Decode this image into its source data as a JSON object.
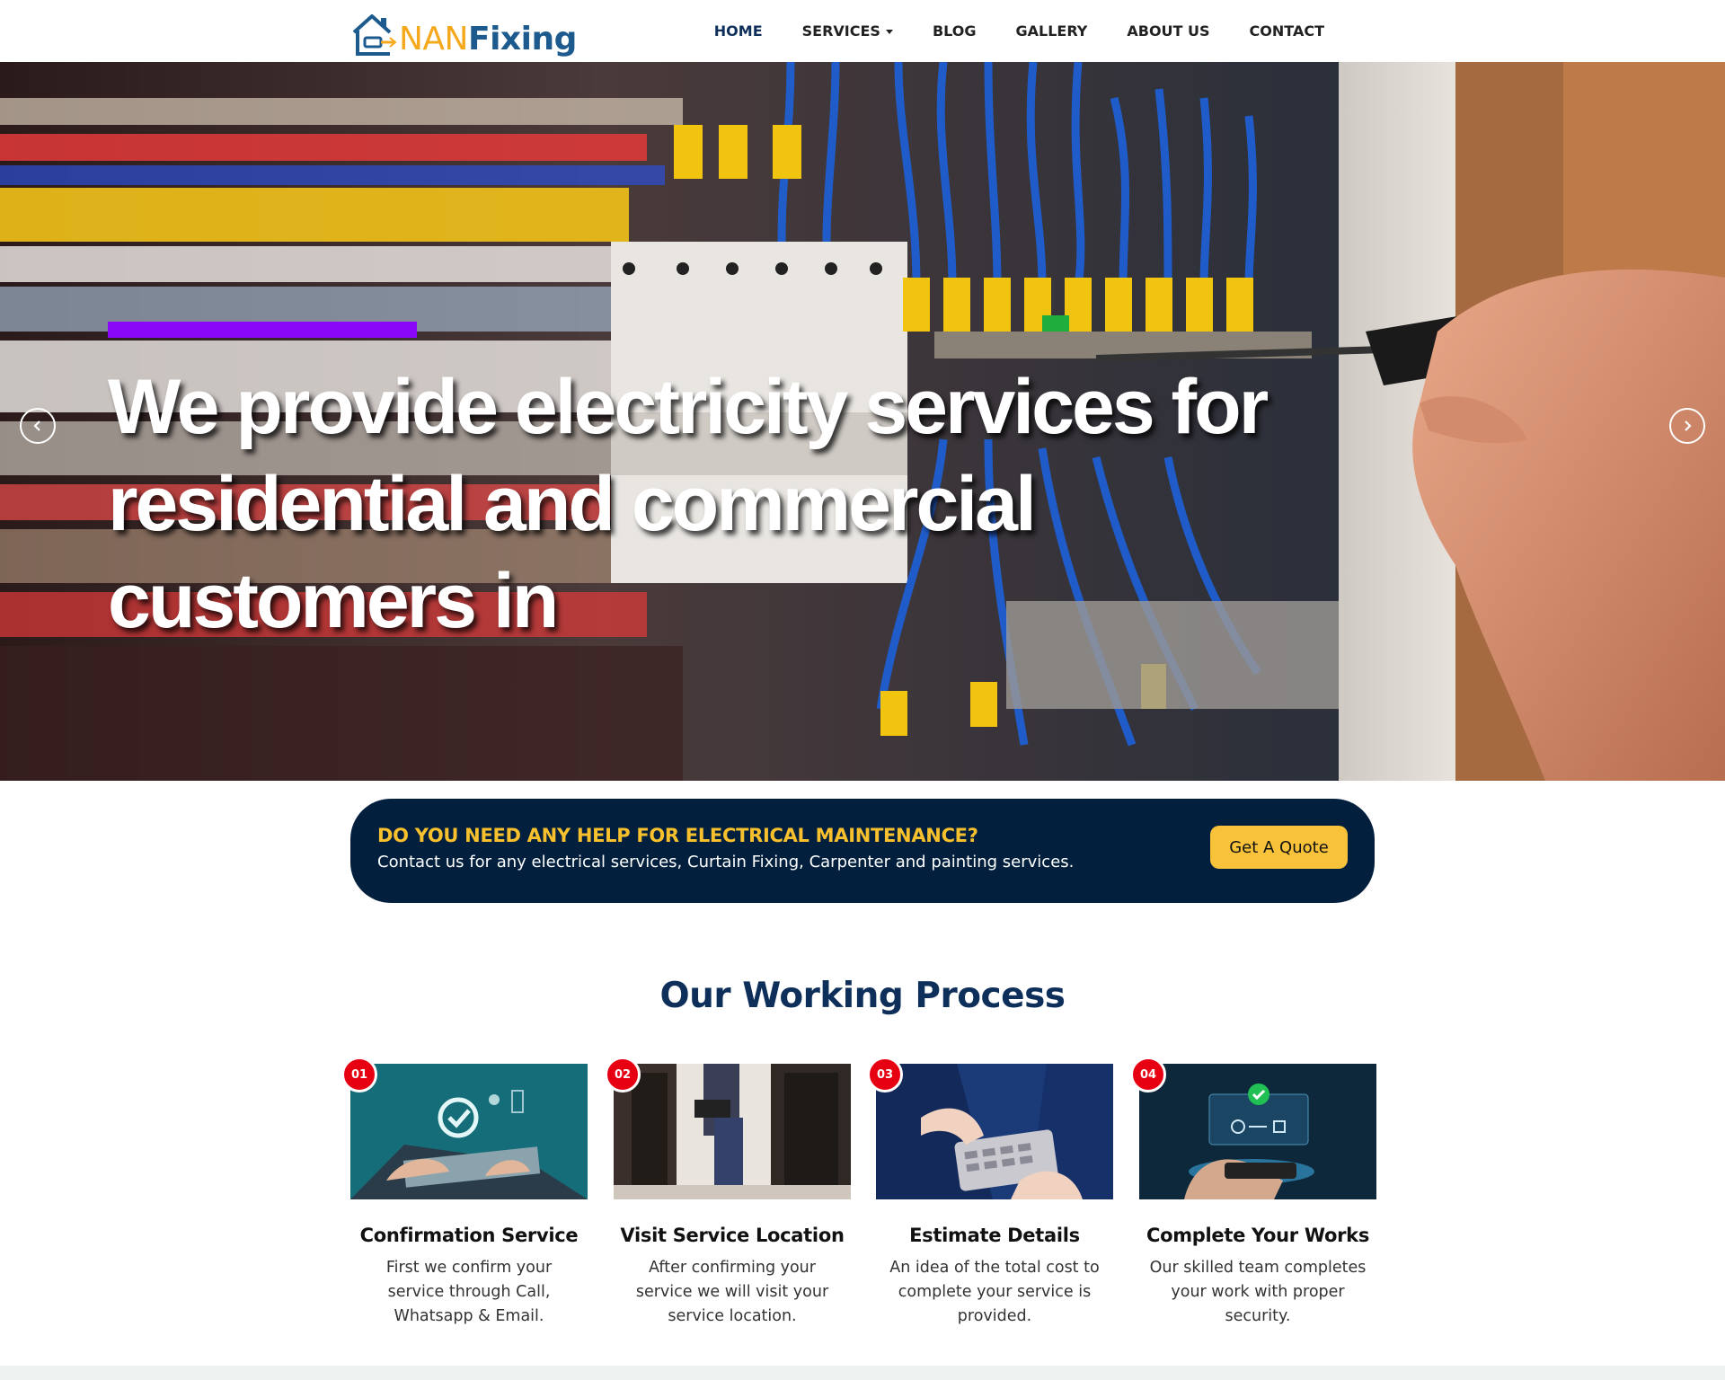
{
  "brand": {
    "name_part1": "NAN",
    "name_part2": "Fixing"
  },
  "nav": {
    "items": [
      {
        "label": "HOME",
        "active": true
      },
      {
        "label": "SERVICES",
        "dropdown": true
      },
      {
        "label": "BLOG"
      },
      {
        "label": "GALLERY"
      },
      {
        "label": "ABOUT US"
      },
      {
        "label": "CONTACT"
      }
    ]
  },
  "hero": {
    "title": "We provide electricity services for residential and commercial customers in",
    "accent_color": "#8a08f5"
  },
  "cta": {
    "title": "DO YOU NEED ANY HELP FOR ELECTRICAL MAINTENANCE?",
    "subtitle": "Contact us for any electrical services, Curtain Fixing, Carpenter and painting services.",
    "button_label": "Get A Quote"
  },
  "process": {
    "title": "Our Working Process",
    "steps": [
      {
        "number": "01",
        "title": "Confirmation Service",
        "description": "First we confirm your service through Call, Whatsapp & Email.",
        "icon": "laptop-verified-image"
      },
      {
        "number": "02",
        "title": "Visit Service Location",
        "description": "After confirming your service we will visit your service location.",
        "icon": "technician-visit-image"
      },
      {
        "number": "03",
        "title": "Estimate Details",
        "description": "An idea of the total cost to complete your service is provided.",
        "icon": "calculator-estimate-image"
      },
      {
        "number": "04",
        "title": "Complete Your Works",
        "description": "Our skilled team completes your work with proper security.",
        "icon": "payment-successful-image"
      }
    ]
  },
  "colors": {
    "navy": "#02203d",
    "yellow": "#f7c02c",
    "badge_red": "#e60012",
    "title_blue": "#0e2f5a"
  }
}
